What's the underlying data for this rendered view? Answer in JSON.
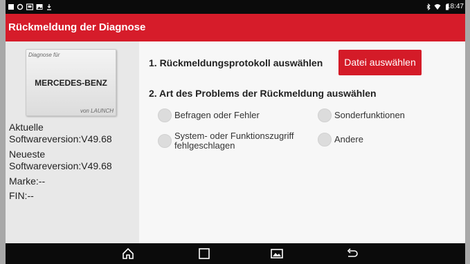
{
  "status_bar": {
    "time": "18:47",
    "left_icons": [
      "square-notification-icon",
      "sync-icon",
      "image-notification-icon",
      "gallery-notification-icon",
      "download-icon"
    ],
    "right_icons": [
      "bluetooth-icon",
      "wifi-icon",
      "battery-icon"
    ]
  },
  "header": {
    "title": "Rückmeldung der Diagnose",
    "color": "#d61c2a"
  },
  "left_panel": {
    "brand_card": {
      "top_text": "Diagnose für",
      "brand": "MERCEDES-BENZ",
      "bottom_text": "von LAUNCH"
    },
    "current_version_label": "Aktuelle",
    "current_version_value": "Softwareversion:V49.68",
    "latest_version_label": "Neueste",
    "latest_version_value": "Softwareversion:V49.68",
    "brand_line": "Marke:--",
    "fin_line": "FIN:--"
  },
  "main": {
    "step1_label": "1. Rückmeldungsprotokoll auswählen",
    "file_button_label": "Datei auswählen",
    "step2_label": "2. Art des Problems der Rückmeldung auswählen",
    "options": {
      "befragen": "Befragen oder Fehler",
      "sonder": "Sonderfunktionen",
      "system_line1": "System- oder Funktionszugriff",
      "system_line2": "fehlgeschlagen",
      "andere": "Andere"
    }
  },
  "nav_bar": {
    "buttons": [
      "home-icon",
      "recents-icon",
      "gallery-icon",
      "back-icon"
    ]
  }
}
